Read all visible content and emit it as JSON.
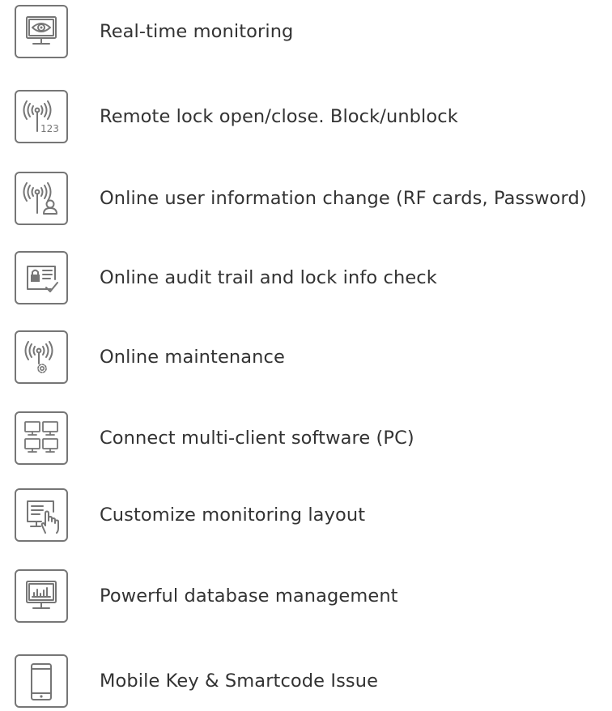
{
  "features": [
    {
      "icon": "monitor-eye-icon",
      "label": "Real-time monitoring"
    },
    {
      "icon": "antenna-numbers-icon",
      "label": "Remote lock open/close. Block/unblock"
    },
    {
      "icon": "antenna-user-icon",
      "label": "Online user information change (RF cards, Password)"
    },
    {
      "icon": "lock-list-check-icon",
      "label": "Online audit trail and lock info check"
    },
    {
      "icon": "antenna-gear-icon",
      "label": "Online maintenance"
    },
    {
      "icon": "multi-monitor-icon",
      "label": "Connect multi-client software (PC)"
    },
    {
      "icon": "monitor-hand-icon",
      "label": "Customize monitoring layout"
    },
    {
      "icon": "monitor-chart-icon",
      "label": "Powerful database management"
    },
    {
      "icon": "smartphone-icon",
      "label": "Mobile Key & Smartcode Issue"
    }
  ],
  "colors": {
    "icon_stroke": "#767676",
    "text": "#333333",
    "background": "#ffffff"
  }
}
